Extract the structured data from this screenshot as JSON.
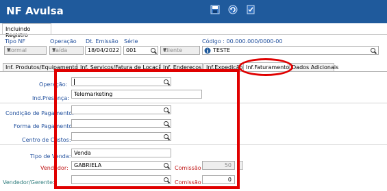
{
  "window": {
    "title": "NF Avulsa"
  },
  "toolbar": {
    "icons": [
      "save-icon",
      "refresh-icon",
      "checklist-icon"
    ]
  },
  "state_tab": {
    "label": "Incluindo Registro"
  },
  "header": {
    "tipo_nf_label": "Tipo NF",
    "tipo_nf_value": "Normal",
    "operacao_label": "Operação",
    "operacao_value": "Saída",
    "dt_emissao_label": "Dt. Emissão",
    "dt_emissao_value": "18/04/2022",
    "serie_label": "Série",
    "serie_value": "001",
    "cliente_value": "Cliente",
    "codigo_label": "Código : 00.000.000/0000-00",
    "codigo_value": "TESTE"
  },
  "tabs": [
    {
      "label": "Inf. Produtos/Equipamentos"
    },
    {
      "label": "Inf. Serviços/Fatura de Locação"
    },
    {
      "label": "Inf. Endereços"
    },
    {
      "label": "Inf.Expedição"
    },
    {
      "label": "Inf.Faturamento"
    },
    {
      "label": "Dados Adicionais"
    }
  ],
  "form": {
    "operacao_label": "Operação:",
    "operacao_value": "",
    "ind_presenca_label": "Ind.Presença:",
    "ind_presenca_value": "Telemarketing",
    "condicao_pagamento_label": "Condição de Pagamento:",
    "condicao_pagamento_value": "",
    "forma_pagamento_label": "Forma de Pagamento:",
    "forma_pagamento_value": "",
    "centro_custos_label": "Centro de Custos:",
    "centro_custos_value": "",
    "tipo_venda_label": "Tipo de Venda:",
    "tipo_venda_value": "Venda",
    "vendedor_label": "Vendedor:",
    "vendedor_value": "GABRIELA",
    "comissao_label": "Comissão :",
    "comissao_value": "50",
    "vendedor_gerente_label": "Vendedor/Gerente:",
    "vendedor_gerente_value": "",
    "comissao2_label": "Comissão :",
    "comissao2_value": "0"
  },
  "colors": {
    "title_bar": "#1f5a9c",
    "highlight": "#e00000",
    "label_blue": "#1f4e9c",
    "label_red": "#c01818",
    "label_teal": "#2e7d7d"
  }
}
